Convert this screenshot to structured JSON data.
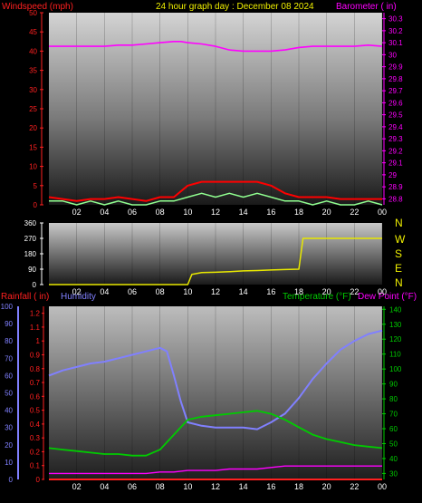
{
  "header": {
    "left_title": "Windspeed (mph)",
    "center_title": "24 hour graph day : December 08 2024",
    "right_title": "Barometer ( in)"
  },
  "colors": {
    "wind": "#ff0000",
    "gust": "#90ff90",
    "baro": "#ff00ff",
    "dir": "#e8e800",
    "rain": "#ff2020",
    "humidity": "#8080ff",
    "temp": "#00cc00",
    "dew": "#ff00ff",
    "white": "#ffffff"
  },
  "compass": [
    "N",
    "W",
    "S",
    "E",
    "N"
  ],
  "chart_data": [
    {
      "type": "line",
      "name": "wind_baro",
      "x_ticks": [
        "02",
        "04",
        "06",
        "08",
        "10",
        "12",
        "14",
        "16",
        "18",
        "20",
        "22",
        "00"
      ],
      "left_axis": {
        "label": "Windspeed (mph)",
        "ticks": [
          "0",
          "5",
          "10",
          "15",
          "20",
          "25",
          "30",
          "35",
          "40",
          "45",
          "50"
        ],
        "range": [
          0,
          50
        ]
      },
      "right_axis": {
        "label": "Barometer ( in)",
        "ticks": [
          "28.8",
          "28.9",
          "29",
          "29.1",
          "29.2",
          "29.3",
          "29.4",
          "29.5",
          "29.6",
          "29.7",
          "29.8",
          "29.9",
          "30",
          "30.1",
          "30.2",
          "30.3"
        ],
        "range": [
          28.75,
          30.35
        ]
      },
      "series": [
        {
          "name": "Barometer",
          "axis": "right",
          "x": [
            0,
            1,
            2,
            3,
            4,
            5,
            6,
            7,
            8,
            9,
            9.5,
            10,
            11,
            12,
            13,
            14,
            15,
            16,
            17,
            18,
            19,
            20,
            21,
            22,
            23,
            24
          ],
          "values": [
            30.07,
            30.07,
            30.07,
            30.07,
            30.07,
            30.08,
            30.08,
            30.09,
            30.1,
            30.11,
            30.11,
            30.1,
            30.09,
            30.07,
            30.04,
            30.03,
            30.03,
            30.03,
            30.04,
            30.06,
            30.07,
            30.07,
            30.07,
            30.07,
            30.08,
            30.07
          ]
        },
        {
          "name": "Wind speed",
          "axis": "left",
          "x": [
            0,
            1,
            2,
            3,
            4,
            5,
            6,
            7,
            8,
            9,
            10,
            11,
            12,
            13,
            14,
            15,
            16,
            17,
            18,
            19,
            20,
            21,
            22,
            23,
            24
          ],
          "values": [
            2,
            1.5,
            1,
            1.5,
            1.5,
            2,
            1.5,
            1,
            2,
            2,
            5,
            6,
            6,
            6,
            6,
            6,
            5,
            3,
            2,
            2,
            2,
            1.5,
            1.5,
            1.5,
            1.5
          ]
        },
        {
          "name": "Wind gust",
          "axis": "left",
          "x": [
            0,
            1,
            2,
            3,
            4,
            5,
            6,
            7,
            8,
            9,
            10,
            11,
            12,
            13,
            14,
            15,
            16,
            17,
            18,
            19,
            20,
            21,
            22,
            23,
            24
          ],
          "values": [
            1,
            1,
            0,
            1,
            0,
            1,
            0,
            0,
            1,
            1,
            2,
            3,
            2,
            3,
            2,
            3,
            2,
            1,
            1,
            0,
            1,
            0,
            0,
            1,
            0
          ]
        }
      ]
    },
    {
      "type": "line",
      "name": "wind_direction",
      "x_ticks": [
        "02",
        "04",
        "06",
        "08",
        "10",
        "12",
        "14",
        "16",
        "18",
        "20",
        "22",
        "00"
      ],
      "left_axis": {
        "ticks": [
          "0",
          "90",
          "180",
          "270",
          "360"
        ],
        "range": [
          0,
          360
        ]
      },
      "series": [
        {
          "name": "Wind direction",
          "x": [
            0,
            10,
            10.3,
            11,
            12,
            13,
            14,
            15,
            16,
            17,
            18,
            18.3,
            24
          ],
          "values": [
            0,
            0,
            60,
            70,
            72,
            75,
            80,
            82,
            85,
            88,
            90,
            270,
            270
          ]
        }
      ]
    },
    {
      "type": "line",
      "name": "rain_humidity_temp",
      "x_ticks": [
        "02",
        "04",
        "06",
        "08",
        "10",
        "12",
        "14",
        "16",
        "18",
        "20",
        "22",
        "00"
      ],
      "labels": {
        "rainfall": "Rainfall ( in)",
        "humidity": "Humidity",
        "temperature": "Temperature (°F)",
        "dewpoint": "Dew Point (°F)"
      },
      "humidity_axis": {
        "ticks": [
          "0",
          "10",
          "20",
          "30",
          "40",
          "50",
          "60",
          "70",
          "80",
          "90",
          "100"
        ],
        "range": [
          0,
          100
        ]
      },
      "rain_axis": {
        "ticks": [
          "0",
          "0.1",
          "0.2",
          "0.3",
          "0.4",
          "0.5",
          "0.6",
          "0.7",
          "0.8",
          "0.9",
          "1",
          "1.1",
          "1.2"
        ],
        "range": [
          0,
          1.25
        ]
      },
      "temp_axis": {
        "ticks": [
          "30",
          "40",
          "50",
          "60",
          "70",
          "80",
          "90",
          "100",
          "110",
          "120",
          "130",
          "140"
        ],
        "range": [
          26,
          142
        ]
      },
      "series": [
        {
          "name": "Humidity",
          "axis": "humidity",
          "x": [
            0,
            1,
            2,
            3,
            4,
            5,
            6,
            7,
            8,
            8.5,
            9,
            9.5,
            10,
            11,
            12,
            13,
            14,
            15,
            16,
            17,
            18,
            19,
            20,
            21,
            22,
            23,
            24
          ],
          "values": [
            60,
            63,
            65,
            67,
            68,
            70,
            72,
            74,
            76,
            74,
            60,
            45,
            33,
            31,
            30,
            30,
            30,
            29,
            33,
            38,
            47,
            58,
            67,
            75,
            80,
            84,
            86
          ]
        },
        {
          "name": "Temperature",
          "axis": "temp",
          "x": [
            0,
            1,
            2,
            3,
            4,
            5,
            6,
            7,
            8,
            9,
            10,
            11,
            12,
            13,
            14,
            15,
            16,
            17,
            18,
            19,
            20,
            21,
            22,
            23,
            24
          ],
          "values": [
            47,
            46,
            45,
            44,
            43,
            43,
            42,
            42,
            46,
            56,
            66,
            68,
            69,
            70,
            71,
            72,
            70,
            66,
            61,
            56,
            53,
            51,
            49,
            48,
            47
          ]
        },
        {
          "name": "Dew Point",
          "axis": "temp",
          "x": [
            0,
            2,
            4,
            6,
            7,
            8,
            9,
            10,
            11,
            12,
            13,
            14,
            15,
            16,
            17,
            18,
            20,
            22,
            24
          ],
          "values": [
            30,
            30,
            30,
            30,
            30,
            31,
            31,
            32,
            32,
            32,
            33,
            33,
            33,
            34,
            35,
            35,
            35,
            35,
            35
          ]
        },
        {
          "name": "Rainfall",
          "axis": "rain",
          "x": [
            0,
            24
          ],
          "values": [
            0,
            0
          ]
        }
      ]
    }
  ]
}
